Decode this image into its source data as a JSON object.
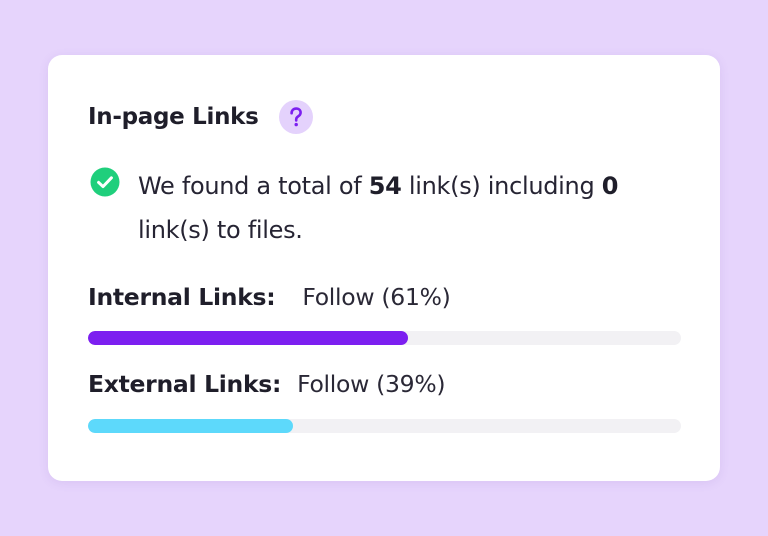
{
  "widget": {
    "title": "In-page Links",
    "help_icon": "question-mark-icon",
    "status_icon": "check-circle-icon",
    "summary": {
      "prefix": "We found a total of ",
      "total_links": "54",
      "middle": " link(s) including ",
      "file_links": "0",
      "suffix": " link(s) to files."
    },
    "internal": {
      "label": "Internal Links:",
      "value": "Follow (61%)",
      "bar_fraction": 0.54,
      "color": "#7c1ff0"
    },
    "external": {
      "label": "External Links:",
      "value": "Follow (39%)",
      "bar_fraction": 0.345,
      "color": "#5dd9fb"
    },
    "colors": {
      "background": "#e6d4fc",
      "card": "#ffffff",
      "accent_purple": "#7c1ff0",
      "success_green": "#1fcf7c",
      "help_bg": "#e4d2fc",
      "track": "#f2f1f4"
    }
  }
}
